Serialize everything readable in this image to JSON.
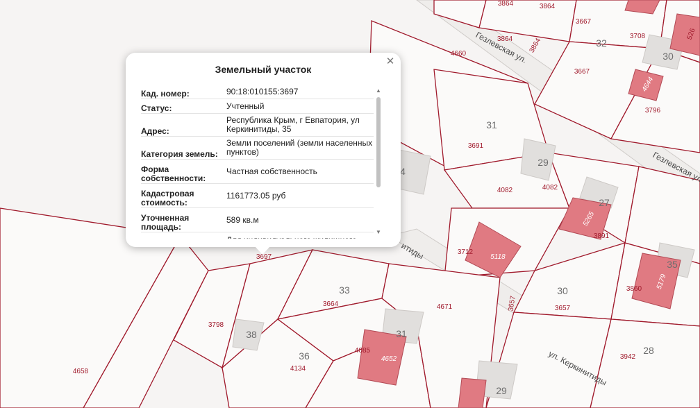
{
  "map": {
    "parcel_numbers": [
      "32",
      "30",
      "31",
      "29",
      "27",
      "33",
      "30",
      "35",
      "38",
      "36",
      "31",
      "28",
      "29",
      "4"
    ],
    "cadastral_numbers": [
      "3864",
      "3864",
      "3667",
      "3708",
      "3864",
      "3864",
      "4660",
      "3667",
      "3796",
      "3691",
      "4082",
      "4082",
      "3891",
      "3712",
      "3697",
      "3664",
      "4671",
      "3657",
      "3657",
      "3860",
      "3798",
      "4085",
      "4134",
      "4658",
      "3942",
      "526"
    ],
    "building_numbers": [
      "4644",
      "5265",
      "5118",
      "5179",
      "4652"
    ],
    "streets": [
      "Гезлевская ул.",
      "Гезлевская ул.",
      "ул. Керкинитиды",
      "итиды"
    ],
    "colors": {
      "parcel_border": "#a01a2c",
      "building": "#e07a82",
      "background": "#f6f4f3"
    }
  },
  "popup": {
    "title": "Земельный участок",
    "close_icon": "close-icon",
    "rows": [
      {
        "key": "Кад. номер:",
        "value": "90:18:010155:3697"
      },
      {
        "key": "Статус:",
        "value": "Учтенный"
      },
      {
        "key": "Адрес:",
        "value": "Республика Крым, г Евпатория, ул Керкинитиды, 35"
      },
      {
        "key": "Категория земель:",
        "value": "Земли поселений (земли населенных пунктов)"
      },
      {
        "key": "Форма собственности:",
        "value": "Частная собственность"
      },
      {
        "key": "Кадастровая стоимость:",
        "value": "1161773.05 руб"
      },
      {
        "key": "Уточненная площадь:",
        "value": "589 кв.м"
      },
      {
        "key": "Разрешенное",
        "value": "Для индивидуального жилищного"
      }
    ]
  }
}
